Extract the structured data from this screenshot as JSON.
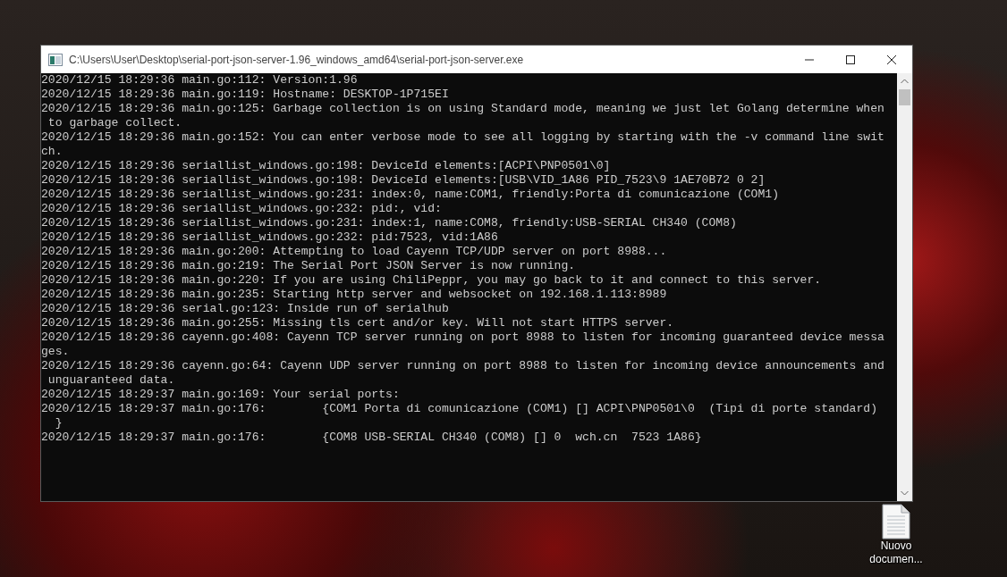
{
  "window": {
    "title": "C:\\Users\\User\\Desktop\\serial-port-json-server-1.96_windows_amd64\\serial-port-json-server.exe"
  },
  "console": {
    "lines": [
      "2020/12/15 18:29:36 main.go:112: Version:1.96",
      "2020/12/15 18:29:36 main.go:119: Hostname: DESKTOP-1P715EI",
      "2020/12/15 18:29:36 main.go:125: Garbage collection is on using Standard mode, meaning we just let Golang determine when",
      " to garbage collect.",
      "2020/12/15 18:29:36 main.go:152: You can enter verbose mode to see all logging by starting with the -v command line swit",
      "ch.",
      "2020/12/15 18:29:36 seriallist_windows.go:198: DeviceId elements:[ACPI\\PNP0501\\0]",
      "2020/12/15 18:29:36 seriallist_windows.go:198: DeviceId elements:[USB\\VID_1A86 PID_7523\\9 1AE70B72 0 2]",
      "2020/12/15 18:29:36 seriallist_windows.go:231: index:0, name:COM1, friendly:Porta di comunicazione (COM1)",
      "2020/12/15 18:29:36 seriallist_windows.go:232: pid:, vid:",
      "2020/12/15 18:29:36 seriallist_windows.go:231: index:1, name:COM8, friendly:USB-SERIAL CH340 (COM8)",
      "2020/12/15 18:29:36 seriallist_windows.go:232: pid:7523, vid:1A86",
      "2020/12/15 18:29:36 main.go:200: Attempting to load Cayenn TCP/UDP server on port 8988...",
      "2020/12/15 18:29:36 main.go:219: The Serial Port JSON Server is now running.",
      "2020/12/15 18:29:36 main.go:220: If you are using ChiliPeppr, you may go back to it and connect to this server.",
      "2020/12/15 18:29:36 main.go:235: Starting http server and websocket on 192.168.1.113:8989",
      "2020/12/15 18:29:36 serial.go:123: Inside run of serialhub",
      "2020/12/15 18:29:36 main.go:255: Missing tls cert and/or key. Will not start HTTPS server.",
      "2020/12/15 18:29:36 cayenn.go:408: Cayenn TCP server running on port 8988 to listen for incoming guaranteed device messa",
      "ges.",
      "2020/12/15 18:29:36 cayenn.go:64: Cayenn UDP server running on port 8988 to listen for incoming device announcements and",
      " unguaranteed data.",
      "2020/12/15 18:29:37 main.go:169: Your serial ports:",
      "2020/12/15 18:29:37 main.go:176:        {COM1 Porta di comunicazione (COM1) [] ACPI\\PNP0501\\0  (Tipi di porte standard)",
      "  }",
      "2020/12/15 18:29:37 main.go:176:        {COM8 USB-SERIAL CH340 (COM8) [] 0  wch.cn  7523 1A86}"
    ]
  },
  "desktop_icons": [
    {
      "label": "Nuovo documen..."
    }
  ]
}
